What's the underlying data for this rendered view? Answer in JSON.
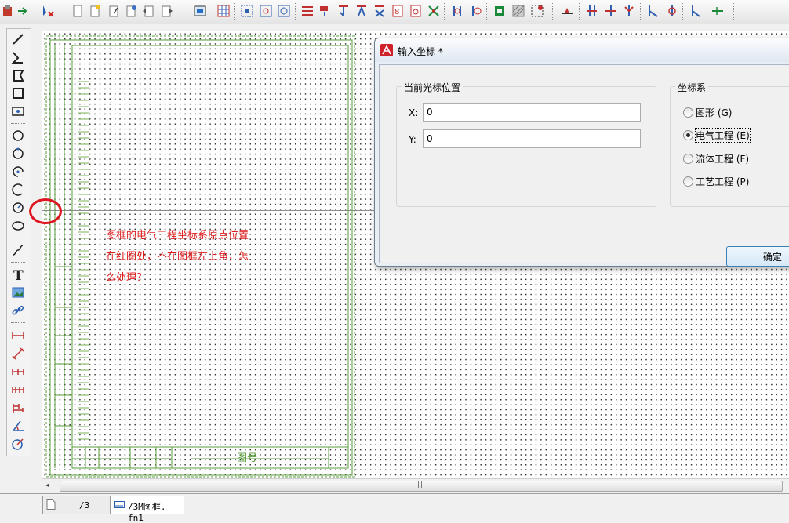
{
  "canvas": {
    "annotation_lines": [
      "图框的电气工程坐标系原点位置",
      "在红圈处，不在图框左上角，怎",
      "么处理？"
    ],
    "title_block_label": "图号"
  },
  "tabs": [
    {
      "label": "/3",
      "active": false
    },
    {
      "label": "/3M图框. fn1",
      "active": true
    }
  ],
  "dialog": {
    "title": "输入坐标 *",
    "position_group": {
      "title": "当前光标位置",
      "x_label": "X:",
      "x_value": "0",
      "y_label": "Y:",
      "y_value": "0"
    },
    "coord_group": {
      "title": "坐标系",
      "options": [
        {
          "label": "图形 (G)",
          "selected": false
        },
        {
          "label": "电气工程 (E)",
          "selected": true
        },
        {
          "label": "流体工程 (F)",
          "selected": false
        },
        {
          "label": "工艺工程 (P)",
          "selected": false
        }
      ]
    },
    "ok_label": "确定"
  },
  "colors": {
    "annotation": "#e01e1e",
    "frame_line": "#5a9e3a",
    "highlight_circle": "#e0141e"
  }
}
